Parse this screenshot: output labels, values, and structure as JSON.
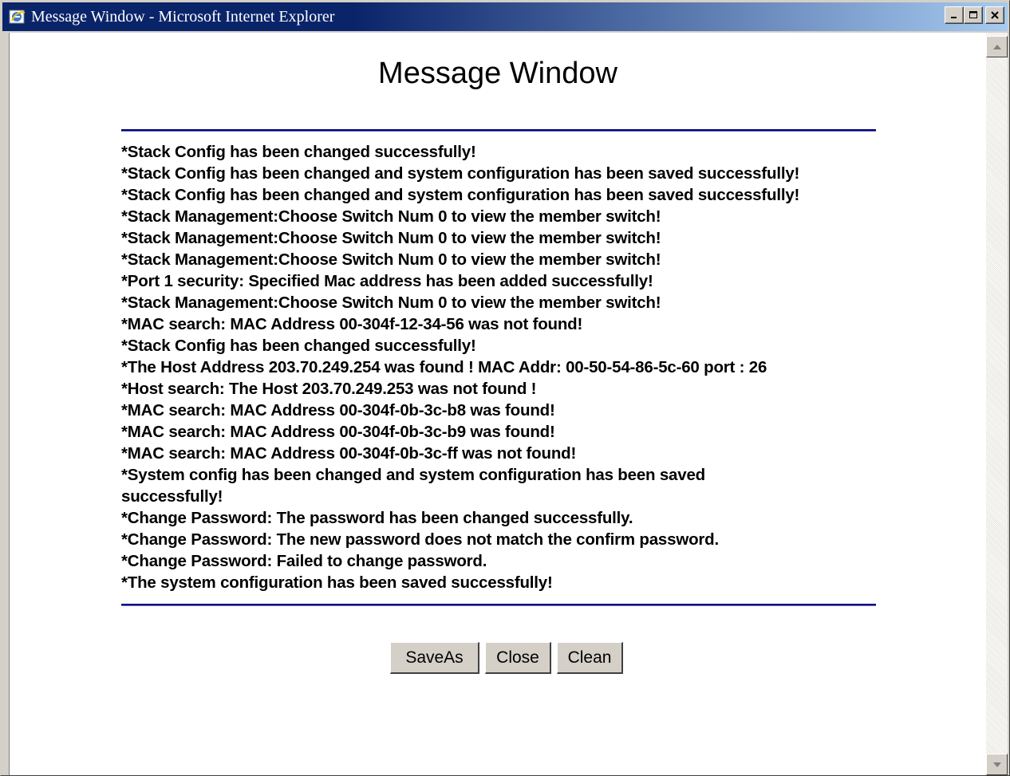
{
  "window": {
    "title": "Message Window - Microsoft Internet Explorer",
    "minimize_glyph": "_",
    "maximize_glyph": "□",
    "close_glyph": "×"
  },
  "page": {
    "heading": "Message Window",
    "messages": [
      "*Stack Config has been changed successfully!",
      "*Stack Config has been changed and system configuration has been saved successfully!",
      "*Stack Config has been changed and system configuration has been saved successfully!",
      "*Stack Management:Choose Switch Num 0 to view the member switch!",
      "*Stack Management:Choose Switch Num 0 to view the member switch!",
      "*Stack Management:Choose Switch Num 0 to view the member switch!",
      "*Port 1 security: Specified Mac address has been added successfully!",
      "*Stack Management:Choose Switch Num 0 to view the member switch!",
      "*MAC search: MAC Address 00-304f-12-34-56 was not found!",
      "*Stack Config has been changed successfully!",
      "*The Host Address 203.70.249.254 was found ! MAC Addr: 00-50-54-86-5c-60 port : 26",
      "*Host search: The Host 203.70.249.253 was not found !",
      "*MAC search: MAC Address 00-304f-0b-3c-b8 was found!",
      "*MAC search: MAC Address 00-304f-0b-3c-b9 was found!",
      "*MAC search: MAC Address 00-304f-0b-3c-ff was not found!",
      "*System config has been changed and system configuration has been saved successfully!",
      "*Change Password: The password has been changed successfully.",
      "*Change Password: The new password does not match the confirm password.",
      "*Change Password: Failed to change password.",
      "*The system configuration has been saved successfully!"
    ]
  },
  "buttons": {
    "saveas": "SaveAs",
    "close": "Close",
    "clean": "Clean"
  },
  "colors": {
    "rule": "#000080",
    "titlebar_start": "#0a246a",
    "titlebar_end": "#a6caf0",
    "chrome": "#d4d0c8"
  }
}
